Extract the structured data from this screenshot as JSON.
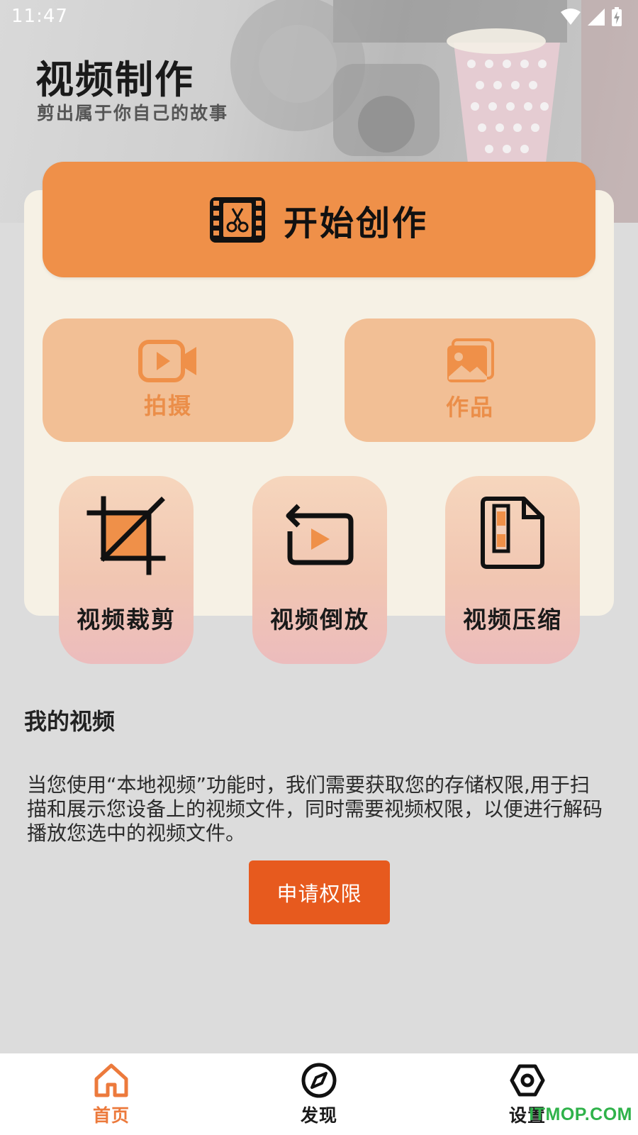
{
  "status_bar": {
    "time": "11:47"
  },
  "hero": {
    "title": "视频制作",
    "subtitle": "剪出属于你自己的故事"
  },
  "start_button": {
    "label": "开始创作",
    "icon": "film-scissors-icon"
  },
  "mid_cards": [
    {
      "label": "拍摄",
      "icon": "video-camera-icon"
    },
    {
      "label": "作品",
      "icon": "gallery-icon"
    }
  ],
  "tools": [
    {
      "label": "视频裁剪",
      "icon": "crop-icon"
    },
    {
      "label": "视频倒放",
      "icon": "reverse-play-icon"
    },
    {
      "label": "视频压缩",
      "icon": "compress-file-icon"
    }
  ],
  "my_videos": {
    "title": "我的视频",
    "notice": "当您使用“本地视频”功能时，我们需要获取您的存储权限,用于扫描和展示您设备上的视频文件，同时需要视频权限，以便进行解码播放您选中的视频文件。",
    "button_label": "申请权限"
  },
  "bottom_nav": [
    {
      "label": "首页",
      "icon": "home-icon",
      "active": true
    },
    {
      "label": "发现",
      "icon": "compass-icon",
      "active": false
    },
    {
      "label": "设置",
      "icon": "settings-hex-icon",
      "active": false
    }
  ],
  "watermark": "ITMOP.COM",
  "colors": {
    "accent_orange": "#ef9049",
    "light_orange": "#f2bf95",
    "permission_button": "#e75a1e",
    "nav_active": "#ec7a3c",
    "panel_bg": "#f6f1e5",
    "page_bg": "#dcdcdc"
  }
}
